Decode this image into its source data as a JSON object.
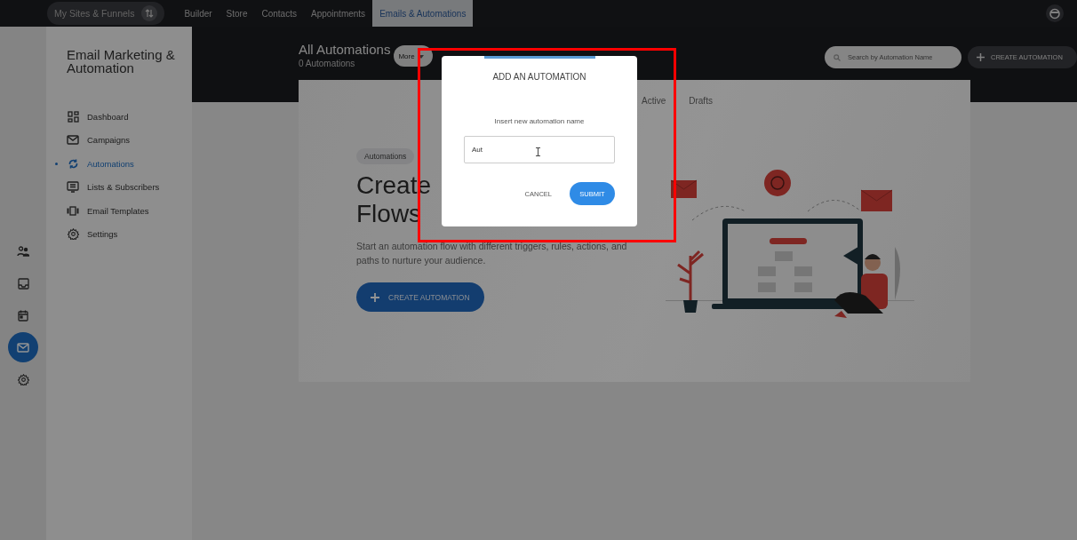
{
  "top_nav": {
    "site_switcher": "My Sites & Funnels",
    "items": [
      {
        "label": "Builder",
        "selected": false
      },
      {
        "label": "Store",
        "selected": false
      },
      {
        "label": "Contacts",
        "selected": false
      },
      {
        "label": "Appointments",
        "selected": false
      },
      {
        "label": "Emails & Automations",
        "selected": true
      }
    ]
  },
  "rail": {
    "items": [
      {
        "kind": "people",
        "selected": false
      },
      {
        "kind": "inbox",
        "selected": false
      },
      {
        "kind": "calendar",
        "selected": false
      },
      {
        "kind": "mail",
        "selected": true
      },
      {
        "kind": "gear",
        "selected": false
      }
    ]
  },
  "sidebar": {
    "title": "Email Marketing & Automation",
    "items": [
      {
        "label": "Dashboard",
        "kind": "dashboard",
        "selected": false
      },
      {
        "label": "Campaigns",
        "kind": "mail",
        "selected": false
      },
      {
        "label": "Automations",
        "kind": "sync",
        "selected": true
      },
      {
        "label": "Lists & Subscribers",
        "kind": "list",
        "selected": false
      },
      {
        "label": "Email Templates",
        "kind": "templates",
        "selected": false
      },
      {
        "label": "Settings",
        "kind": "gear",
        "selected": false
      }
    ]
  },
  "header": {
    "title": "All Automations",
    "count": "0 Automations",
    "more_button": "More",
    "search": {
      "placeholder": "Search by Automation Name"
    },
    "create_button": "CREATE AUTOMATION"
  },
  "tabs": [
    {
      "label": "Active",
      "selected": false
    },
    {
      "label": "Drafts",
      "selected": false
    }
  ],
  "hero": {
    "badge": "Automations",
    "heading_lines": [
      "Create",
      "Flows"
    ],
    "description": "Start an automation flow with different triggers, rules, actions, and paths to nurture your audience.",
    "button": "CREATE AUTOMATION"
  },
  "modal": {
    "title": "ADD AN AUTOMATION",
    "label": "Insert new automation name",
    "value": "Aut",
    "cancel": "CANCEL",
    "submit": "SUBMIT"
  }
}
